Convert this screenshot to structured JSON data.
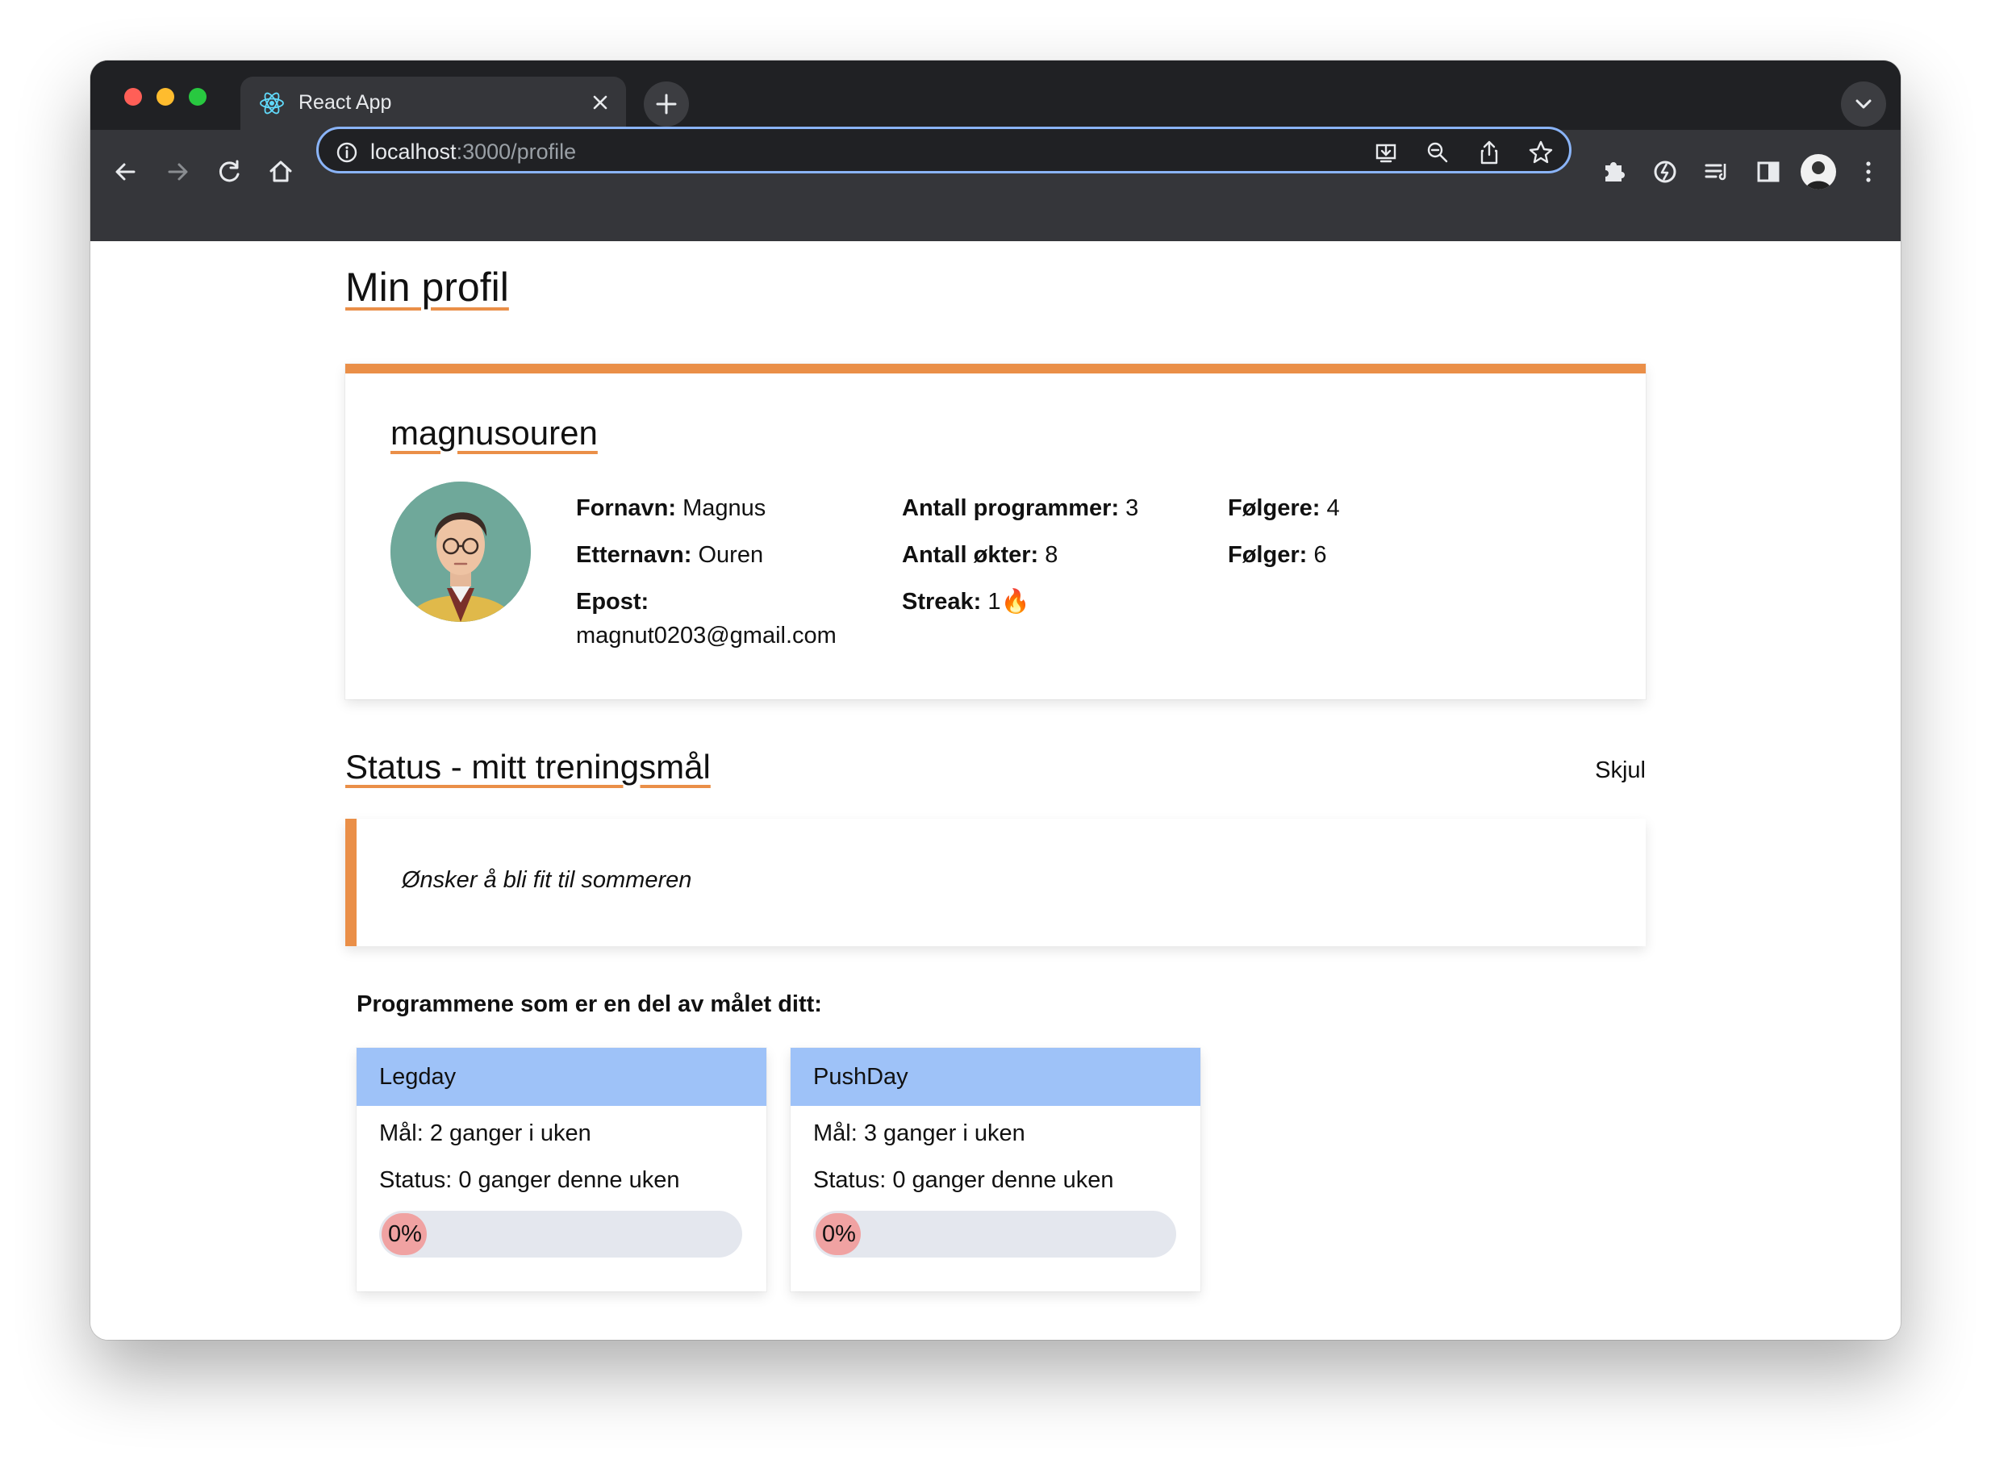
{
  "browser": {
    "tab_title": "React App",
    "url_host": "localhost",
    "url_rest": ":3000/profile"
  },
  "page": {
    "title": "Min profil",
    "accent_color": "#ea8f48",
    "program_header_color": "#9ec2f8"
  },
  "profile": {
    "username": "magnusouren",
    "first_name_label": "Fornavn:",
    "first_name": "Magnus",
    "last_name_label": "Etternavn:",
    "last_name": "Ouren",
    "email_label": "Epost:",
    "email": "magnut0203@gmail.com",
    "programs_count_label": "Antall programmer:",
    "programs_count": "3",
    "sessions_count_label": "Antall økter:",
    "sessions_count": "8",
    "streak_label": "Streak:",
    "streak": "1🔥",
    "followers_label": "Følgere:",
    "followers": "4",
    "following_label": "Følger:",
    "following": "6"
  },
  "status": {
    "title": "Status - mitt treningsmål",
    "hide_label": "Skjul",
    "goal_text": "Ønsker å bli fit til sommeren",
    "programs_label": "Programmene som er en del av målet ditt:"
  },
  "programs": [
    {
      "name": "Legday",
      "goal": "Mål: 2 ganger i uken",
      "status": "Status: 0 ganger denne uken",
      "progress_label": "0%",
      "progress": 0
    },
    {
      "name": "PushDay",
      "goal": "Mål: 3 ganger i uken",
      "status": "Status: 0 ganger denne uken",
      "progress_label": "0%",
      "progress": 0
    }
  ]
}
